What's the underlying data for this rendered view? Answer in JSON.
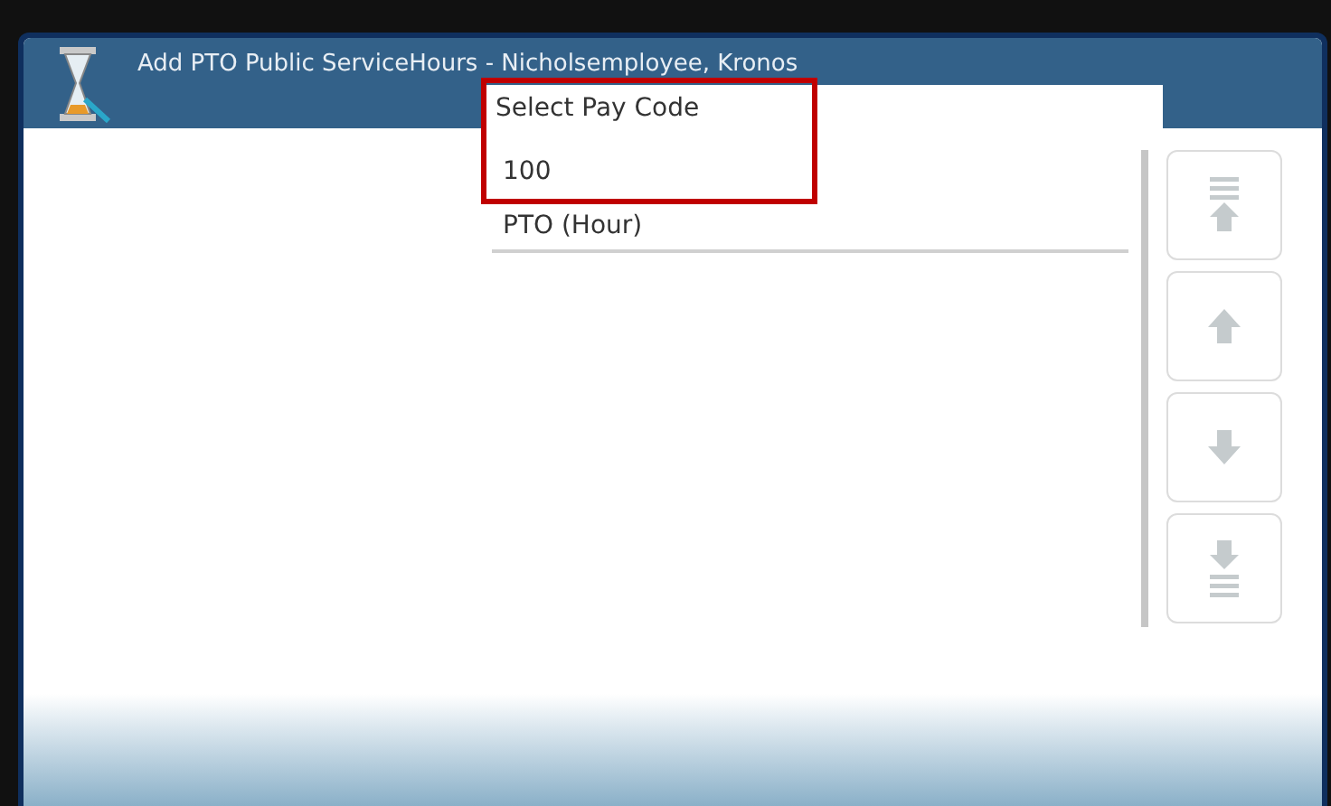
{
  "window": {
    "title": "Add PTO Public ServiceHours - Nicholsemployee, Kronos"
  },
  "pay_code_list": {
    "header": "Select Pay Code",
    "items": [
      "100",
      "PTO (Hour)"
    ]
  },
  "scroll_buttons": [
    {
      "kind": "top",
      "disabled": true
    },
    {
      "kind": "up",
      "disabled": true
    },
    {
      "kind": "down",
      "disabled": true
    },
    {
      "kind": "bottom",
      "disabled": true
    }
  ]
}
